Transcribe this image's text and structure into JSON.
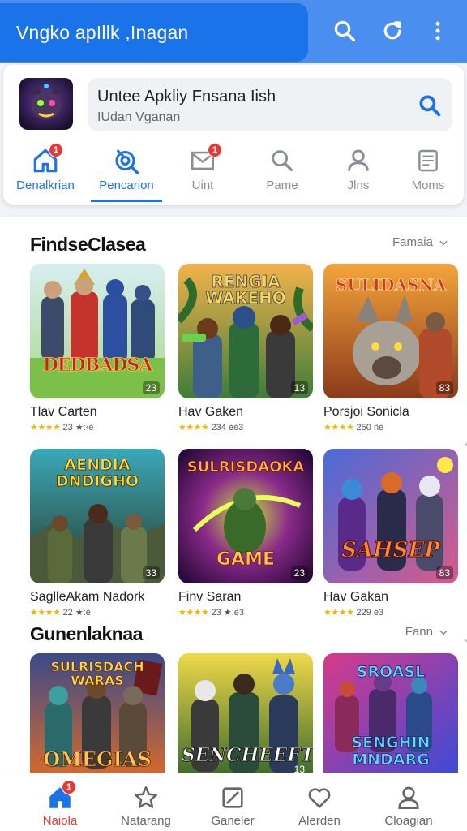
{
  "topbar": {
    "title": "Vngko apIllk ,Inagan",
    "icons": [
      "search-icon",
      "refresh-icon",
      "more-vert-icon"
    ]
  },
  "search": {
    "query": "Untee Apkliy Fnsana Iish",
    "subtext": "IUdan Vganan"
  },
  "tabs": [
    {
      "label": "Denalkrian",
      "icon": "home-icon",
      "badge": "1"
    },
    {
      "label": "Pencarion",
      "icon": "target-icon",
      "badge": ""
    },
    {
      "label": "Uint",
      "icon": "mail-icon",
      "badge": "1"
    },
    {
      "label": "Pame",
      "icon": "search-icon",
      "badge": ""
    },
    {
      "label": "Jlns",
      "icon": "person-icon",
      "badge": ""
    },
    {
      "label": "Moms",
      "icon": "news-icon",
      "badge": ""
    }
  ],
  "sections": [
    {
      "title": "FindseClasea",
      "more": "Famaia",
      "games": [
        {
          "name": "Tlav Carten",
          "rating": "23",
          "extra": "★:‹è",
          "badge": "23",
          "art_title": "DEDBADSA"
        },
        {
          "name": "Hav Gaken",
          "rating": "234",
          "extra": "èè3",
          "badge": "13",
          "art_title": "RENGIA WAKEHO"
        },
        {
          "name": "Porsjoi Sonicla",
          "rating": "250",
          "extra": "ñè",
          "badge": "83",
          "art_title": "SULIDASNA"
        },
        {
          "name": "SaglleAkam Nadork",
          "rating": "22",
          "extra": "★:è",
          "badge": "33",
          "art_title": "AENDIA DNDIGHO"
        },
        {
          "name": "Finv Saran",
          "rating": "23",
          "extra": "★:è3",
          "badge": "23",
          "art_title": "GAME"
        },
        {
          "name": "Hav Gakan",
          "rating": "229",
          "extra": "é3",
          "badge": "83",
          "art_title": "SAHSEP"
        }
      ]
    },
    {
      "title": "Gunenlaknaa",
      "more": "Fann",
      "games": [
        {
          "badge": "",
          "art_title": "OMEGIAS"
        },
        {
          "badge": "13",
          "art_title": "SENCHEEFT"
        },
        {
          "badge": "",
          "art_title": "SENGHIN MNDARG"
        }
      ]
    }
  ],
  "bottom_nav": [
    {
      "label": "Naiola",
      "icon": "home-icon",
      "badge": "1",
      "active": true
    },
    {
      "label": "Natarang",
      "icon": "star-icon",
      "badge": "",
      "active": false
    },
    {
      "label": "Ganeler",
      "icon": "edit-square-icon",
      "badge": "",
      "active": false
    },
    {
      "label": "Alerden",
      "icon": "heart-icon",
      "badge": "",
      "active": false
    },
    {
      "label": "Cloagian",
      "icon": "person-icon",
      "badge": "",
      "active": false
    }
  ],
  "colors": {
    "primary": "#1a73e8",
    "topbar": "#4a8ff0",
    "badge": "#e53935",
    "star": "#f4b400"
  }
}
